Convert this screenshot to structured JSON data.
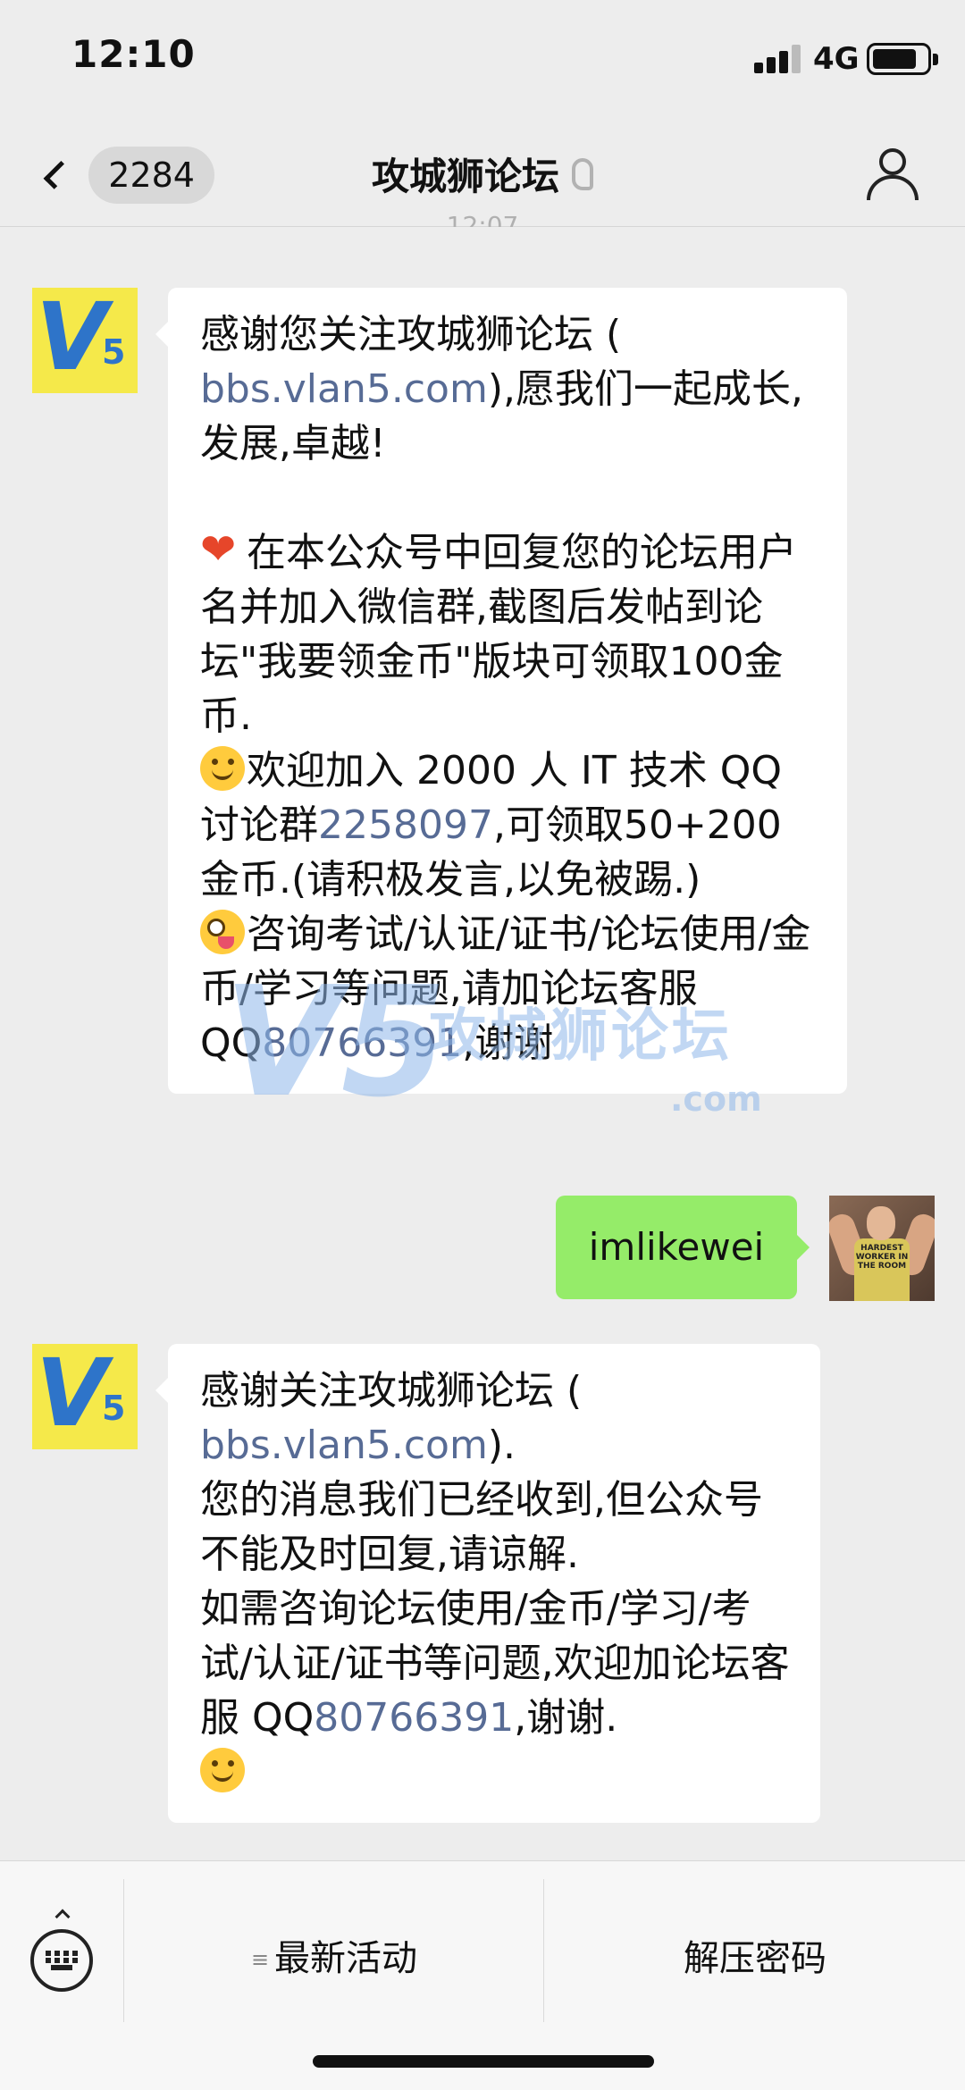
{
  "status_bar": {
    "time": "12:10",
    "network": "4G"
  },
  "nav": {
    "unread_count": "2284",
    "title": "攻城狮论坛",
    "icons": [
      "back-chevron-icon",
      "ear-mute-icon",
      "person-icon"
    ]
  },
  "conversation": {
    "messages": [
      {
        "sender": "account",
        "avatar": "V5",
        "segments": [
          {
            "text": "感谢您关注攻城狮论坛 (\n"
          },
          {
            "text": "bbs.vlan5.com",
            "link": true
          },
          {
            "text": "),愿我们一起成长,发展,卓越!\n\n"
          },
          {
            "emoji": "heart"
          },
          {
            "text": "在本公众号中回复您的论坛用户名并加入微信群,截图后发帖到论坛\"我要领金币\"版块可领取100金币.\n"
          },
          {
            "emoji": "smile"
          },
          {
            "text": "欢迎加入 2000 人 IT 技术 QQ 讨论群"
          },
          {
            "text": "2258097",
            "link": true
          },
          {
            "text": ",可领取50+200金币.(请积极发言,以免被踢.)\n"
          },
          {
            "emoji": "crazy"
          },
          {
            "text": "咨询考试/认证/证书/论坛使用/金币/学习等问题,请加论坛客服 QQ"
          },
          {
            "text": "80766391",
            "link": true
          },
          {
            "text": ",谢谢"
          }
        ]
      },
      {
        "sender": "user",
        "text": "imlikewei",
        "avatar_shirt_text": "HARDEST WORKER IN THE ROOM"
      },
      {
        "sender": "account",
        "avatar": "V5",
        "segments": [
          {
            "text": "感谢关注攻城狮论坛 (\n"
          },
          {
            "text": "bbs.vlan5.com",
            "link": true
          },
          {
            "text": ").\n您的消息我们已经收到,但公众号不能及时回复,请谅解.\n如需咨询论坛使用/金币/学习/考试/认证/证书等问题,欢迎加论坛客服 QQ"
          },
          {
            "text": "80766391",
            "link": true
          },
          {
            "text": ",谢谢.\n"
          },
          {
            "emoji": "smile"
          }
        ]
      }
    ],
    "watermark": {
      "logo": "V5",
      "title": "攻城狮论坛",
      "domain": ".com"
    }
  },
  "bottom_menu": {
    "items": [
      {
        "label": "最新活动",
        "has_submenu": true
      },
      {
        "label": "解压密码",
        "has_submenu": false
      }
    ]
  },
  "colors": {
    "background": "#ededed",
    "incoming_bubble": "#ffffff",
    "outgoing_bubble": "#95ec69",
    "link": "#576b95",
    "avatar_bg": "#f5e94a",
    "avatar_fg": "#2e74c9"
  }
}
